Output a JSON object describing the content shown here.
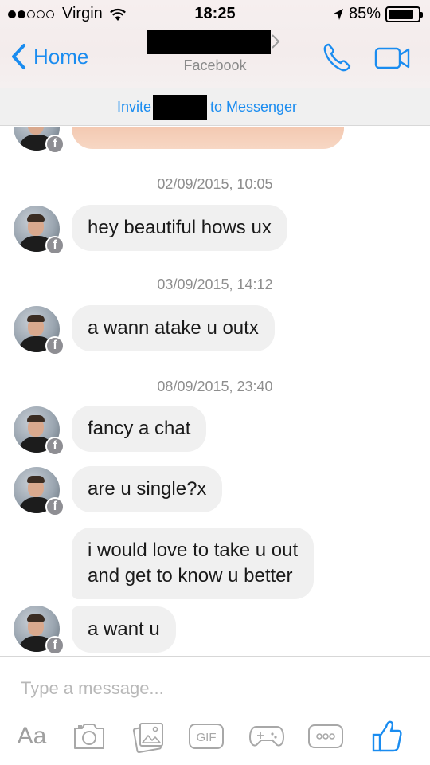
{
  "status_bar": {
    "carrier": "Virgin",
    "time": "18:25",
    "battery": "85%",
    "battery_level": 0.85,
    "signal_dots": [
      true,
      true,
      false,
      false,
      false
    ]
  },
  "header": {
    "back_label": "Home",
    "subtitle": "Facebook",
    "icons": [
      "back-chevron-icon",
      "phone-icon",
      "video-camera-icon"
    ]
  },
  "invite_bar": {
    "prefix": "Invite",
    "suffix": "to Messenger"
  },
  "conversation": {
    "timestamps": [
      "02/09/2015, 10:05",
      "03/09/2015, 14:12",
      "08/09/2015, 23:40"
    ],
    "messages": [
      "hey beautiful hows ux",
      "a wann atake u outx",
      "fancy a chat",
      "are u single?x",
      "i would love to take u out",
      "and get to know u better",
      "a want u"
    ],
    "badge_letter": "f"
  },
  "composer": {
    "placeholder": "Type a message...",
    "aa_label": "Aa",
    "gif_label": "GIF",
    "tools": [
      "camera-icon",
      "photo-gallery-icon",
      "gif-icon",
      "game-controller-icon",
      "more-icon",
      "thumbs-up-icon"
    ]
  },
  "colors": {
    "accent": "#1a8cf0",
    "bubble": "#f0f0f0",
    "timestamp": "#8e8e8e",
    "icon_gray": "#a8a8a8"
  }
}
